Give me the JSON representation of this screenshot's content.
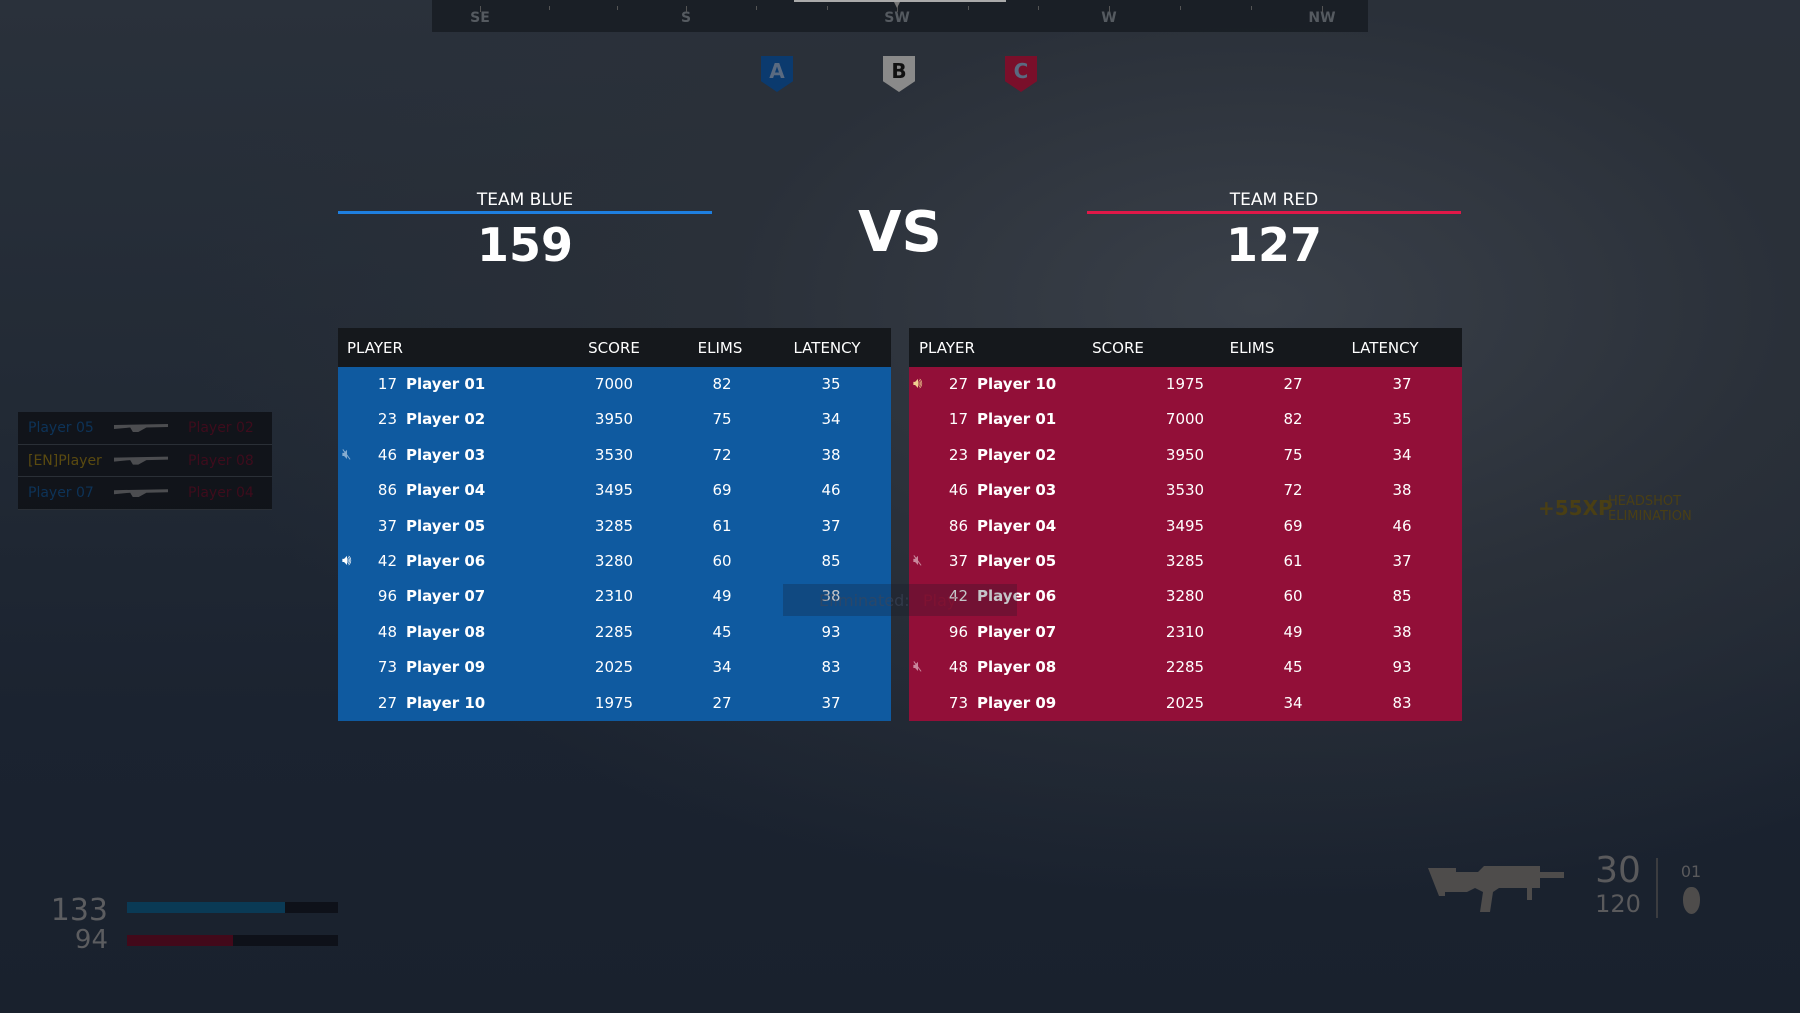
{
  "compass": {
    "marks": [
      "SE",
      "S",
      "SW",
      "W",
      "NW"
    ]
  },
  "objectives": [
    {
      "label": "A",
      "color": "#0b3a6e"
    },
    {
      "label": "B",
      "color": "#8a8a8a"
    },
    {
      "label": "C",
      "color": "#7a0f2a"
    }
  ],
  "team_blue": {
    "name": "TEAM BLUE",
    "score": "159",
    "color": "#0f5aa0",
    "line": "#1e7fe0"
  },
  "team_red": {
    "name": "TEAM RED",
    "score": "127",
    "color": "#920f38",
    "line": "#e01848"
  },
  "vs": "VS",
  "blue_table": {
    "headers": [
      "PLAYER",
      "SCORE",
      "ELIMS",
      "LATENCY"
    ],
    "rows": [
      {
        "voice": "",
        "level": "17",
        "name": "Player 01",
        "score": "7000",
        "elims": "82",
        "latency": "35"
      },
      {
        "voice": "",
        "level": "23",
        "name": "Player 02",
        "score": "3950",
        "elims": "75",
        "latency": "34"
      },
      {
        "voice": "muted",
        "level": "46",
        "name": "Player 03",
        "score": "3530",
        "elims": "72",
        "latency": "38"
      },
      {
        "voice": "",
        "level": "86",
        "name": "Player 04",
        "score": "3495",
        "elims": "69",
        "latency": "46"
      },
      {
        "voice": "",
        "level": "37",
        "name": "Player 05",
        "score": "3285",
        "elims": "61",
        "latency": "37"
      },
      {
        "voice": "speaking",
        "level": "42",
        "name": "Player 06",
        "score": "3280",
        "elims": "60",
        "latency": "85"
      },
      {
        "voice": "",
        "level": "96",
        "name": "Player 07",
        "score": "2310",
        "elims": "49",
        "latency": "38"
      },
      {
        "voice": "",
        "level": "48",
        "name": "Player 08",
        "score": "2285",
        "elims": "45",
        "latency": "93"
      },
      {
        "voice": "",
        "level": "73",
        "name": "Player 09",
        "score": "2025",
        "elims": "34",
        "latency": "83"
      },
      {
        "voice": "",
        "level": "27",
        "name": "Player 10",
        "score": "1975",
        "elims": "27",
        "latency": "37"
      }
    ]
  },
  "red_table": {
    "headers": [
      "PLAYER",
      "SCORE",
      "ELIMS",
      "LATENCY"
    ],
    "rows": [
      {
        "voice": "speaking",
        "level": "27",
        "name": "Player 10",
        "score": "1975",
        "elims": "27",
        "latency": "37"
      },
      {
        "voice": "",
        "level": "17",
        "name": "Player 01",
        "score": "7000",
        "elims": "82",
        "latency": "35"
      },
      {
        "voice": "",
        "level": "23",
        "name": "Player 02",
        "score": "3950",
        "elims": "75",
        "latency": "34"
      },
      {
        "voice": "",
        "level": "46",
        "name": "Player 03",
        "score": "3530",
        "elims": "72",
        "latency": "38"
      },
      {
        "voice": "",
        "level": "86",
        "name": "Player 04",
        "score": "3495",
        "elims": "69",
        "latency": "46"
      },
      {
        "voice": "muted",
        "level": "37",
        "name": "Player 05",
        "score": "3285",
        "elims": "61",
        "latency": "37"
      },
      {
        "voice": "",
        "level": "42",
        "name": "Player 06",
        "score": "3280",
        "elims": "60",
        "latency": "85"
      },
      {
        "voice": "",
        "level": "96",
        "name": "Player 07",
        "score": "2310",
        "elims": "49",
        "latency": "38"
      },
      {
        "voice": "muted",
        "level": "48",
        "name": "Player 08",
        "score": "2285",
        "elims": "45",
        "latency": "93"
      },
      {
        "voice": "",
        "level": "73",
        "name": "Player 09",
        "score": "2025",
        "elims": "34",
        "latency": "83"
      }
    ]
  },
  "killfeed": [
    {
      "killer": "Player 05",
      "killer_color": "#0d3358",
      "victim": "Player 02"
    },
    {
      "killer": "[EN]Player",
      "killer_color": "#5a4a10",
      "victim": "Player 08"
    },
    {
      "killer": "Player 07",
      "killer_color": "#0d3358",
      "victim": "Player 04"
    }
  ],
  "xp": {
    "amount": "+55XP",
    "line1": "HEADSHOT",
    "line2": "ELIMINATION"
  },
  "toast": {
    "text": "Eliminated:",
    "name": "Play"
  },
  "health": {
    "shield": "133",
    "shield_fraction": 0.75,
    "health": "94",
    "health_fraction": 0.5
  },
  "ammo": {
    "magazine": "30",
    "reserve": "120",
    "grenades": "01"
  }
}
